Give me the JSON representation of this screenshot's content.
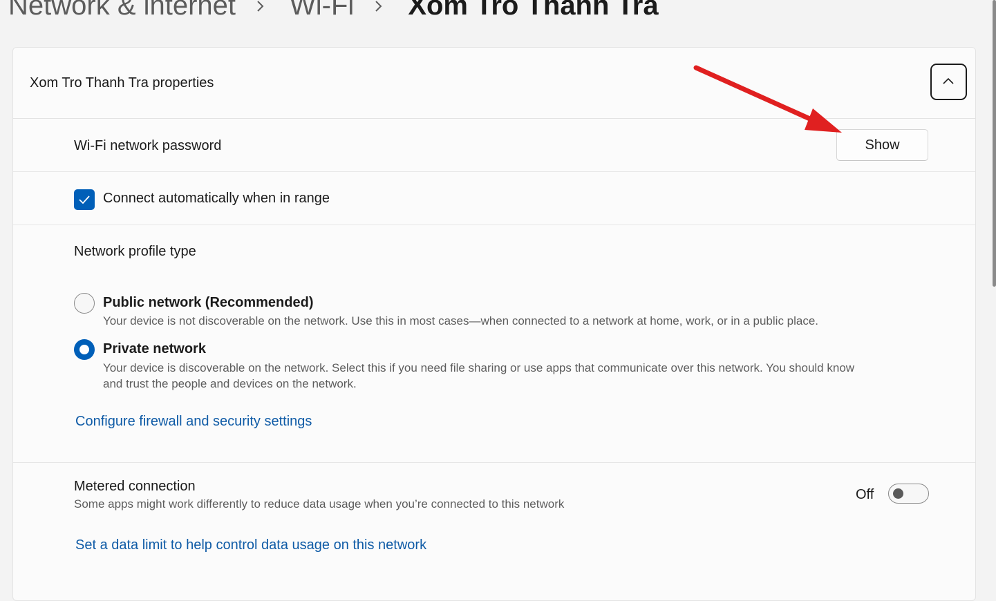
{
  "breadcrumb": {
    "items": [
      "Network & internet",
      "Wi-Fi"
    ],
    "current": "Xom Tro Thanh Tra"
  },
  "properties": {
    "title": "Xom Tro Thanh Tra properties",
    "collapse_icon": "chevron-up-icon"
  },
  "password": {
    "label": "Wi-Fi network password",
    "button_label": "Show"
  },
  "auto_connect": {
    "label": "Connect automatically when in range",
    "checked": true
  },
  "profile": {
    "heading": "Network profile type",
    "options": [
      {
        "title": "Public network (Recommended)",
        "description": "Your device is not discoverable on the network. Use this in most cases—when connected to a network at home, work, or in a public place.",
        "selected": false
      },
      {
        "title": "Private network",
        "description_line1": "Your device is discoverable on the network. Select this if you need file sharing or use apps that communicate over this network. You should know",
        "description_line2": "and trust the people and devices on the network.",
        "selected": true
      }
    ],
    "firewall_link": "Configure firewall and security settings"
  },
  "metered": {
    "title": "Metered connection",
    "description": "Some apps might work differently to reduce data usage when you’re connected to this network",
    "state": "Off",
    "data_limit_link": "Set a data limit to help control data usage on this network"
  },
  "colors": {
    "accent": "#005fb8",
    "link": "#0f5ba6",
    "annotation_arrow": "#e02020"
  }
}
